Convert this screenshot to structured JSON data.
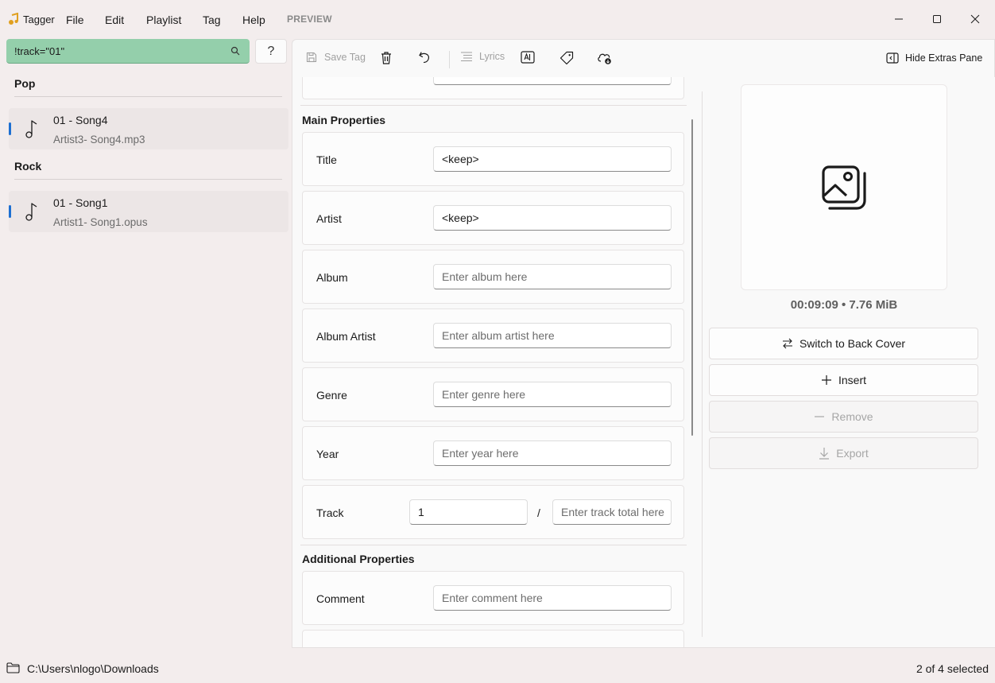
{
  "app": {
    "name": "Tagger",
    "preview_label": "PREVIEW",
    "menu": [
      "File",
      "Edit",
      "Playlist",
      "Tag",
      "Help"
    ]
  },
  "search": {
    "value": "!track=\"01\"",
    "help_label": "?"
  },
  "library": {
    "groups": [
      {
        "name": "Pop",
        "songs": [
          {
            "title": "01 - Song4",
            "subtitle": "Artist3- Song4.mp3"
          }
        ]
      },
      {
        "name": "Rock",
        "songs": [
          {
            "title": "01 - Song1",
            "subtitle": "Artist1- Song1.opus"
          }
        ]
      }
    ]
  },
  "toolbar": {
    "save_label": "Save Tag",
    "lyrics_label": "Lyrics",
    "hide_extras_label": "Hide Extras Pane"
  },
  "main_properties": {
    "heading": "Main Properties",
    "title": {
      "label": "Title",
      "value": "<keep>"
    },
    "artist": {
      "label": "Artist",
      "value": "<keep>"
    },
    "album": {
      "label": "Album",
      "placeholder": "Enter album here"
    },
    "album_artist": {
      "label": "Album Artist",
      "placeholder": "Enter album artist here"
    },
    "genre": {
      "label": "Genre",
      "placeholder": "Enter genre here"
    },
    "year": {
      "label": "Year",
      "placeholder": "Enter year here"
    },
    "track": {
      "label": "Track",
      "value": "1",
      "separator": "/",
      "total_placeholder": "Enter track total here"
    }
  },
  "additional_properties": {
    "heading": "Additional Properties",
    "comment": {
      "label": "Comment",
      "placeholder": "Enter comment here"
    }
  },
  "extras": {
    "duration_size": "00:09:09 • 7.76 MiB",
    "switch_label": "Switch to Back Cover",
    "insert_label": "Insert",
    "remove_label": "Remove",
    "export_label": "Export"
  },
  "status": {
    "path": "C:\\Users\\nlogo\\Downloads",
    "selection": "2 of 4 selected"
  }
}
